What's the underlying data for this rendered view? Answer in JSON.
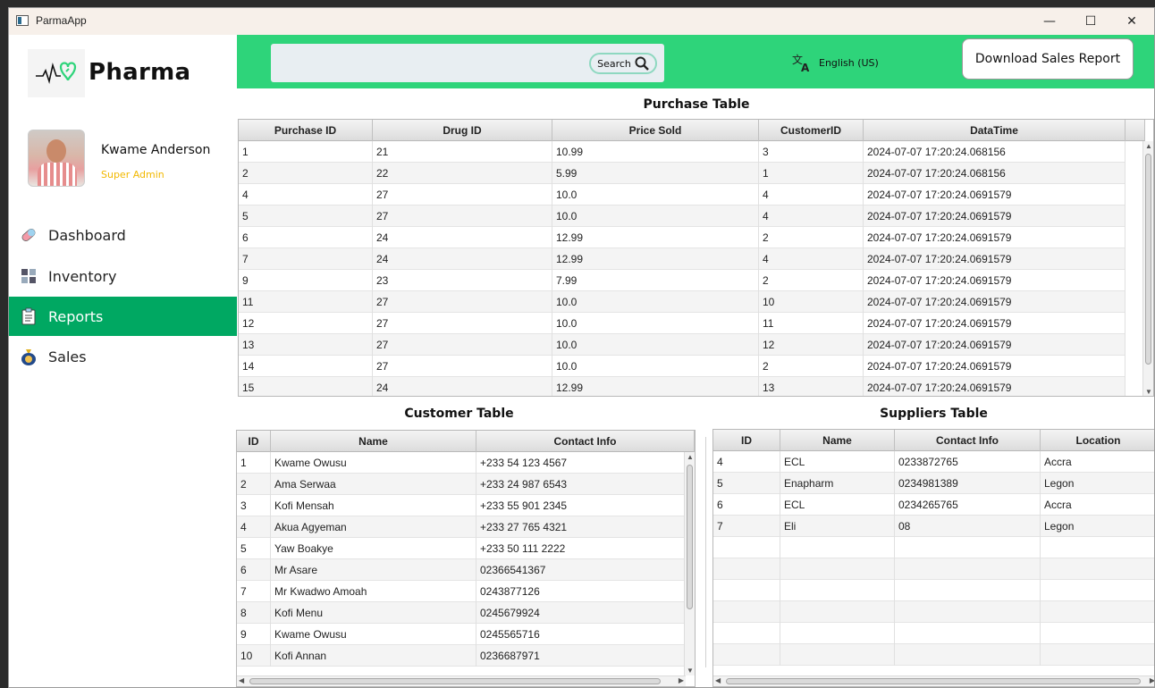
{
  "window": {
    "title": "ParmaApp",
    "minimize": "—",
    "maximize": "☐",
    "close": "✕"
  },
  "sidebar": {
    "brand": "Pharma",
    "user": {
      "name": "Kwame Anderson",
      "role": "Super Admin"
    },
    "items": [
      {
        "label": "Dashboard",
        "icon": "pill-icon"
      },
      {
        "label": "Inventory",
        "icon": "grid-icon"
      },
      {
        "label": "Reports",
        "icon": "clipboard-icon",
        "active": true
      },
      {
        "label": "Sales",
        "icon": "money-bag-icon"
      }
    ]
  },
  "topbar": {
    "search": {
      "placeholder": "",
      "button_label": "Search"
    },
    "language": "English (US)",
    "download_label": "Download Sales Report"
  },
  "purchase": {
    "title": "Purchase Table",
    "columns": [
      "Purchase ID",
      "Drug ID",
      "Price Sold",
      "CustomerID",
      "DataTime"
    ],
    "rows": [
      [
        "1",
        "21",
        "10.99",
        "3",
        "2024-07-07 17:20:24.068156"
      ],
      [
        "2",
        "22",
        "5.99",
        "1",
        "2024-07-07 17:20:24.068156"
      ],
      [
        "4",
        "27",
        "10.0",
        "4",
        "2024-07-07 17:20:24.0691579"
      ],
      [
        "5",
        "27",
        "10.0",
        "4",
        "2024-07-07 17:20:24.0691579"
      ],
      [
        "6",
        "24",
        "12.99",
        "2",
        "2024-07-07 17:20:24.0691579"
      ],
      [
        "7",
        "24",
        "12.99",
        "4",
        "2024-07-07 17:20:24.0691579"
      ],
      [
        "9",
        "23",
        "7.99",
        "2",
        "2024-07-07 17:20:24.0691579"
      ],
      [
        "11",
        "27",
        "10.0",
        "10",
        "2024-07-07 17:20:24.0691579"
      ],
      [
        "12",
        "27",
        "10.0",
        "11",
        "2024-07-07 17:20:24.0691579"
      ],
      [
        "13",
        "27",
        "10.0",
        "12",
        "2024-07-07 17:20:24.0691579"
      ],
      [
        "14",
        "27",
        "10.0",
        "2",
        "2024-07-07 17:20:24.0691579"
      ],
      [
        "15",
        "24",
        "12.99",
        "13",
        "2024-07-07 17:20:24.0691579"
      ]
    ]
  },
  "customer": {
    "title": "Customer Table",
    "columns": [
      "ID",
      "Name",
      "Contact Info"
    ],
    "rows": [
      [
        "1",
        "Kwame Owusu",
        "+233 54 123 4567"
      ],
      [
        "2",
        "Ama Serwaa",
        "+233 24 987 6543"
      ],
      [
        "3",
        "Kofi Mensah",
        "+233 55 901 2345"
      ],
      [
        "4",
        "Akua Agyeman",
        "+233 27 765 4321"
      ],
      [
        "5",
        "Yaw Boakye",
        "+233 50 111 2222"
      ],
      [
        "6",
        "Mr Asare",
        "02366541367"
      ],
      [
        "7",
        "Mr Kwadwo Amoah",
        "0243877126"
      ],
      [
        "8",
        "Kofi Menu",
        "0245679924"
      ],
      [
        "9",
        "Kwame Owusu",
        "0245565716"
      ],
      [
        "10",
        "Kofi Annan",
        "0236687971"
      ]
    ]
  },
  "suppliers": {
    "title": "Suppliers Table",
    "columns": [
      "ID",
      "Name",
      "Contact Info",
      "Location"
    ],
    "rows": [
      [
        "4",
        "ECL",
        "0233872765",
        "Accra"
      ],
      [
        "5",
        "Enapharm",
        "0234981389",
        "Legon"
      ],
      [
        "6",
        "ECL",
        "0234265765",
        "Accra"
      ],
      [
        "7",
        "Eli",
        "08",
        "Legon"
      ]
    ]
  }
}
